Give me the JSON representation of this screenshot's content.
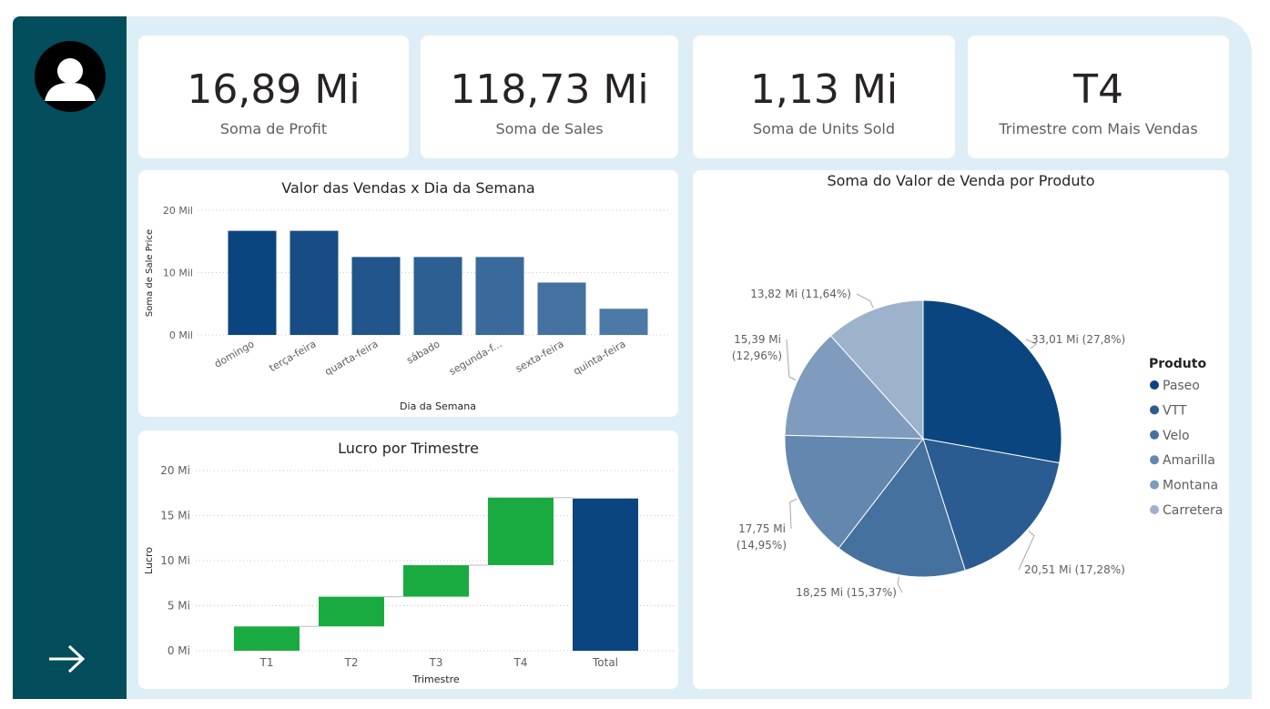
{
  "kpis": [
    {
      "value": "16,89 Mi",
      "label": "Soma de Profit"
    },
    {
      "value": "118,73 Mi",
      "label": "Soma de Sales"
    },
    {
      "value": "1,13 Mi",
      "label": "Soma de Units Sold"
    },
    {
      "value": "T4",
      "label": "Trimestre com Mais Vendas"
    }
  ],
  "colors": {
    "sidebar": "#034d5c",
    "background": "#deeef6",
    "positive": "#1aab40",
    "total": "#0b457f"
  },
  "icons": {
    "avatar": "user-avatar-icon",
    "nav": "arrow-right-icon"
  },
  "chart_data": [
    {
      "type": "bar",
      "title": "Valor das Vendas x Dia da Semana",
      "xlabel": "Dia da Semana",
      "ylabel": "Soma de Sale Price",
      "categories": [
        "domingo",
        "terça-feira",
        "quarta-feira",
        "sábado",
        "segunda-f...",
        "sexta-feira",
        "quinta-feira"
      ],
      "values": [
        16.7,
        16.7,
        12.5,
        12.5,
        12.5,
        8.4,
        4.2
      ],
      "yticks": [
        "0 Mil",
        "10 Mil",
        "20 Mil"
      ],
      "ytick_values": [
        0,
        10,
        20
      ],
      "ylim": [
        0,
        20
      ],
      "unit": "Mil",
      "colors": [
        "#0b457f",
        "#174c85",
        "#21558b",
        "#2d5f93",
        "#3a6a9b",
        "#4471a0",
        "#4d79a6"
      ],
      "grid": true
    },
    {
      "type": "waterfall",
      "title": "Lucro por Trimestre",
      "xlabel": "Trimestre",
      "ylabel": "Lucro",
      "categories": [
        "T1",
        "T2",
        "T3",
        "T4",
        "Total"
      ],
      "values": [
        2.7,
        3.3,
        3.5,
        7.5,
        16.9
      ],
      "yticks": [
        "0 Mi",
        "5 Mi",
        "10 Mi",
        "15 Mi",
        "20 Mi"
      ],
      "ytick_values": [
        0,
        5,
        10,
        15,
        20
      ],
      "ylim": [
        0,
        20
      ],
      "unit": "Mi",
      "grid": true
    },
    {
      "type": "pie",
      "title": "Soma do Valor de Venda por Produto",
      "legend_title": "Produto",
      "legend_position": "right",
      "series": [
        {
          "name": "Paseo",
          "value": 33.01,
          "label": "33,01 Mi (27,8%)",
          "color": "#0b457f"
        },
        {
          "name": "VTT",
          "value": 20.51,
          "label": "20,51 Mi (17,28%)",
          "color": "#2a5c91"
        },
        {
          "name": "Velo",
          "value": 18.25,
          "label": "18,25 Mi (15,37%)",
          "color": "#45719e"
        },
        {
          "name": "Amarilla",
          "value": 17.75,
          "label": "17,75 Mi (14,95%)",
          "color": "#6387ae"
        },
        {
          "name": "Montana",
          "value": 15.39,
          "label": "15,39 Mi (12,96%)",
          "color": "#7f9cbe"
        },
        {
          "name": "Carretera",
          "value": 13.82,
          "label": "13,82 Mi (11,64%)",
          "color": "#9db3cc"
        }
      ]
    }
  ]
}
